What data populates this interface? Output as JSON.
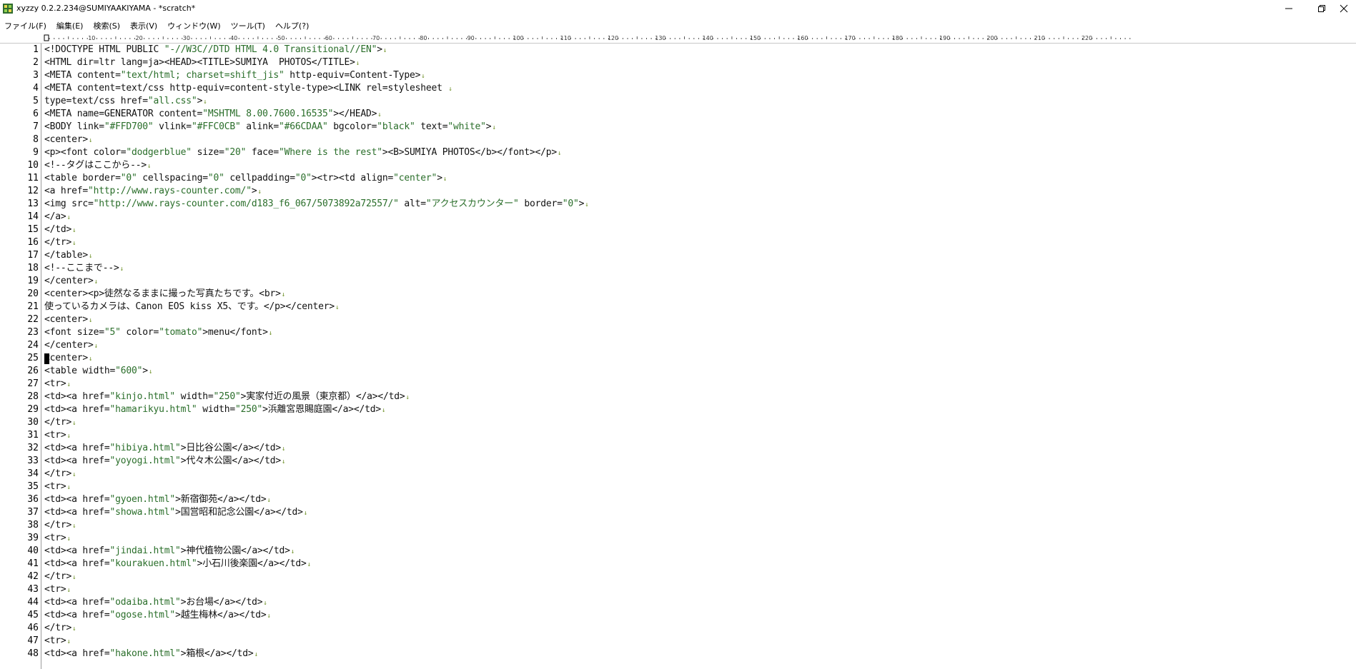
{
  "window": {
    "title": "xyzzy 0.2.2.234@SUMIYAAKIYAMA - *scratch*",
    "icon": "xyzzy-app-icon",
    "controls": [
      "minimize-icon",
      "maximize-icon",
      "close-icon"
    ]
  },
  "menubar": {
    "items": [
      "ファイル(F)",
      "編集(E)",
      "検索(S)",
      "表示(V)",
      "ウィンドウ(W)",
      "ツール(T)",
      "ヘルプ(?)"
    ]
  },
  "ruler": {
    "labels": [
      "10",
      "20",
      "30",
      "40",
      "50",
      "60",
      "70",
      "80",
      "90",
      "100",
      "110",
      "120",
      "130",
      "140",
      "150",
      "160",
      "170",
      "180",
      "190",
      "200",
      "210",
      "220"
    ]
  },
  "editor": {
    "caret_line": 25,
    "eol_mark": "↓",
    "lines": [
      "<!DOCTYPE HTML PUBLIC \"-//W3C//DTD HTML 4.0 Transitional//EN\">",
      "<HTML dir=ltr lang=ja><HEAD><TITLE>SUMIYA  PHOTOS</TITLE>",
      "<META content=\"text/html; charset=shift_jis\" http-equiv=Content-Type>",
      "<META content=text/css http-equiv=content-style-type><LINK rel=stylesheet ",
      "type=text/css href=\"all.css\">",
      "<META name=GENERATOR content=\"MSHTML 8.00.7600.16535\"></HEAD>",
      "<BODY link=\"#FFD700\" vlink=\"#FFC0CB\" alink=\"#66CDAA\" bgcolor=\"black\" text=\"white\">",
      "<center>",
      "<p><font color=\"dodgerblue\" size=\"20\" face=\"Where is the rest\"><B>SUMIYA PHOTOS</b></font></p>",
      "<!--タグはここから-->",
      "<table border=\"0\" cellspacing=\"0\" cellpadding=\"0\"><tr><td align=\"center\">",
      "<a href=\"http://www.rays-counter.com/\">",
      "<img src=\"http://www.rays-counter.com/d183_f6_067/5073892a72557/\" alt=\"アクセスカウンター\" border=\"0\">",
      "</a>",
      "</td>",
      "</tr>",
      "</table>",
      "<!--ここまで-->",
      "</center>",
      "<center><p>徒然なるままに撮った写真たちです。<br>",
      "使っているカメラは、Canon EOS kiss X5、です。</p></center>",
      "<center>",
      "<font size=\"5\" color=\"tomato\">menu</font>",
      "</center>",
      "<center>",
      "<table width=\"600\">",
      "<tr>",
      "<td><a href=\"kinjo.html\" width=\"250\">実家付近の風景（東京都）</a></td>",
      "<td><a href=\"hamarikyu.html\" width=\"250\">浜離宮恩賜庭園</a></td>",
      "</tr>",
      "<tr>",
      "<td><a href=\"hibiya.html\">日比谷公園</a></td>",
      "<td><a href=\"yoyogi.html\">代々木公園</a></td>",
      "</tr>",
      "<tr>",
      "<td><a href=\"gyoen.html\">新宿御苑</a></td>",
      "<td><a href=\"showa.html\">国営昭和記念公園</a></td>",
      "</tr>",
      "<tr>",
      "<td><a href=\"jindai.html\">神代植物公園</a></td>",
      "<td><a href=\"kourakuen.html\">小石川後楽園</a></td>",
      "</tr>",
      "<tr>",
      "<td><a href=\"odaiba.html\">お台場</a></td>",
      "<td><a href=\"ogose.html\">越生梅林</a></td>",
      "</tr>",
      "<tr>",
      "<td><a href=\"hakone.html\">箱根</a></td>"
    ]
  }
}
